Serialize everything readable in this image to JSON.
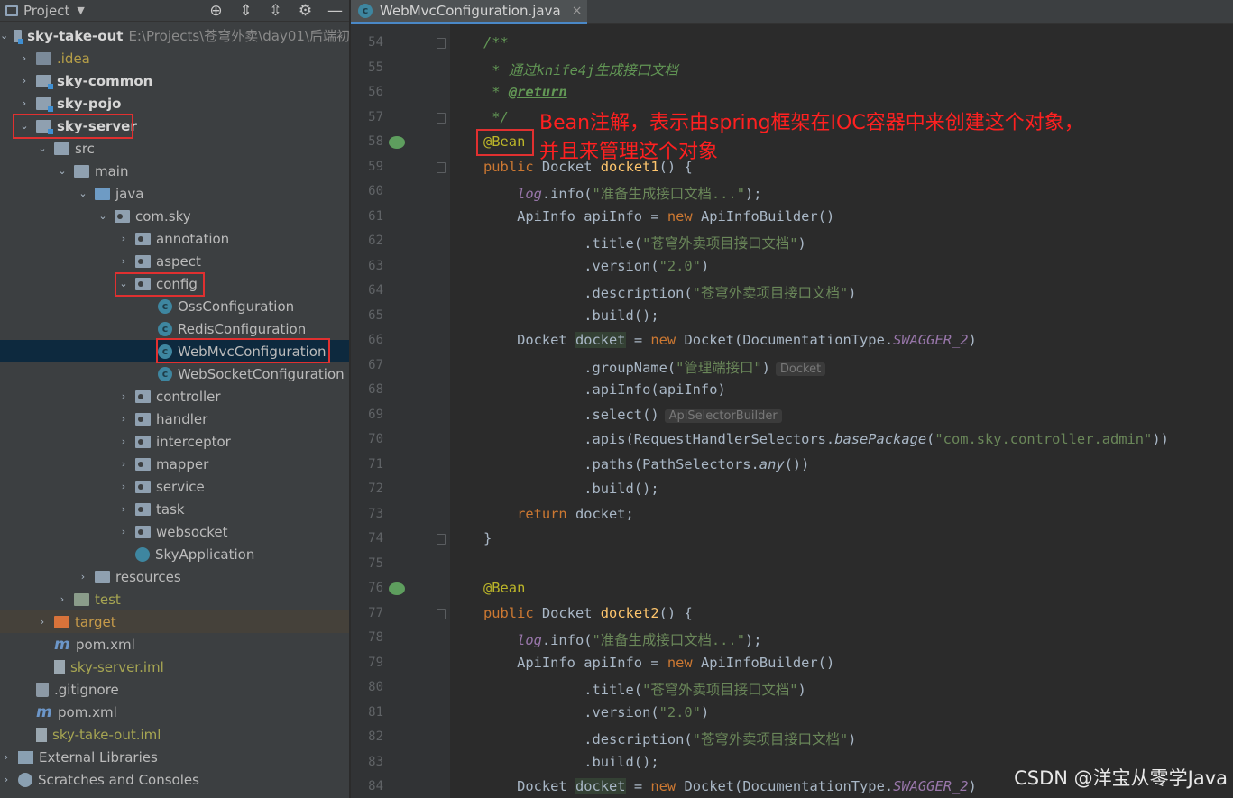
{
  "sidebar": {
    "title": "Project",
    "tree": [
      {
        "label": "sky-take-out",
        "path": "E:\\Projects\\苍穹外卖\\day01\\后端初",
        "bold": true
      },
      {
        "label": ".idea"
      },
      {
        "label": "sky-common",
        "bold": true
      },
      {
        "label": "sky-pojo",
        "bold": true
      },
      {
        "label": "sky-server",
        "bold": true
      },
      {
        "label": "src"
      },
      {
        "label": "main"
      },
      {
        "label": "java"
      },
      {
        "label": "com.sky"
      },
      {
        "label": "annotation"
      },
      {
        "label": "aspect"
      },
      {
        "label": "config"
      },
      {
        "label": "OssConfiguration"
      },
      {
        "label": "RedisConfiguration"
      },
      {
        "label": "WebMvcConfiguration"
      },
      {
        "label": "WebSocketConfiguration"
      },
      {
        "label": "controller"
      },
      {
        "label": "handler"
      },
      {
        "label": "interceptor"
      },
      {
        "label": "mapper"
      },
      {
        "label": "service"
      },
      {
        "label": "task"
      },
      {
        "label": "websocket"
      },
      {
        "label": "SkyApplication"
      },
      {
        "label": "resources"
      },
      {
        "label": "test"
      },
      {
        "label": "target"
      },
      {
        "label": "pom.xml"
      },
      {
        "label": "sky-server.iml"
      },
      {
        "label": ".gitignore"
      },
      {
        "label": "pom.xml"
      },
      {
        "label": "sky-take-out.iml"
      },
      {
        "label": "External Libraries"
      },
      {
        "label": "Scratches and Consoles"
      }
    ]
  },
  "editor": {
    "tab_label": "WebMvcConfiguration.java",
    "line_numbers": [
      "54",
      "55",
      "56",
      "57",
      "58",
      "59",
      "60",
      "61",
      "62",
      "63",
      "64",
      "65",
      "66",
      "67",
      "68",
      "69",
      "70",
      "71",
      "72",
      "73",
      "74",
      "75",
      "76",
      "77",
      "78",
      "79",
      "80",
      "81",
      "82",
      "83",
      "84"
    ],
    "strings": {
      "comment_open": "/**",
      "comment_line": " * 通过knife4j生成接口文档",
      "comment_star": " * ",
      "return_tag": "@return",
      "comment_close": " */",
      "bean": "@Bean",
      "public": "public",
      "docket_type": "Docket",
      "docket1": "docket1",
      "docket2": "docket2",
      "sig_end": "() {",
      "log": "log",
      "info_call": ".info(",
      "log_msg": "\"准备生成接口文档...\"",
      "close_semi": ");",
      "apiinfo_decl": "ApiInfo apiInfo = ",
      "new": "new",
      "apiinfo_builder": " ApiInfoBuilder()",
      "title_call": ".title(",
      "title_val": "\"苍穹外卖项目接口文档\"",
      "version_call": ".version(",
      "version_val": "\"2.0\"",
      "desc_call": ".description(",
      "desc_val": "\"苍穹外卖项目接口文档\"",
      "close_paren": ")",
      "build_call": ".build();",
      "docket_decl_pre": "Docket ",
      "docket_var": "docket",
      "docket_decl_mid": " = ",
      "docket_ctor": " Docket(DocumentationType.",
      "swagger": "SWAGGER_2",
      "group_call": ".groupName(",
      "group_val": "\"管理端接口\"",
      "hint_docket": "Docket",
      "apiinfo_call": ".apiInfo(apiInfo)",
      "select_call": ".select()",
      "hint_selector": "ApiSelectorBuilder",
      "apis_call": ".apis(RequestHandlerSelectors.",
      "base_package": "basePackage",
      "open_paren": "(",
      "pkg_val": "\"com.sky.controller.admin\"",
      "double_close": "))",
      "paths_call": ".paths(PathSelectors.",
      "any": "any",
      "paths_end": "())",
      "return_kw": "return",
      "return_val": " docket;",
      "brace_close": "}"
    }
  },
  "annotation": {
    "line1": "Bean注解，表示由spring框架在IOC容器中来创建这个对象，",
    "line2": "并且来管理这个对象"
  },
  "watermark": "CSDN @洋宝从零学Java"
}
